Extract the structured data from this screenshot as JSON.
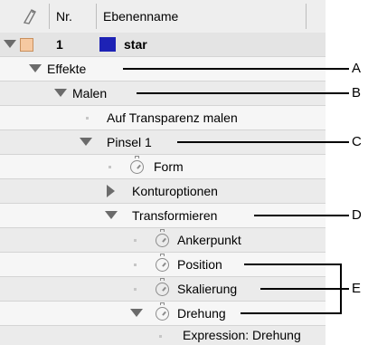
{
  "header": {
    "nr_label": "Nr.",
    "name_label": "Ebenenname"
  },
  "layer": {
    "number": "1",
    "name": "star",
    "label_color": "#f6c9a1",
    "solid_color": "#1d22b5"
  },
  "tree": {
    "effects": "Effekte",
    "paint": "Malen",
    "paint_transparent": "Auf Transparenz malen",
    "brush": "Pinsel 1",
    "shape": "Form",
    "stroke_options": "Konturoptionen",
    "transform": "Transformieren",
    "anchor": "Ankerpunkt",
    "position": "Position",
    "scale": "Skalierung",
    "rotation": "Drehung",
    "expression": "Expression: Drehung"
  },
  "callouts": {
    "a": "A",
    "b": "B",
    "c": "C",
    "d": "D",
    "e": "E"
  }
}
